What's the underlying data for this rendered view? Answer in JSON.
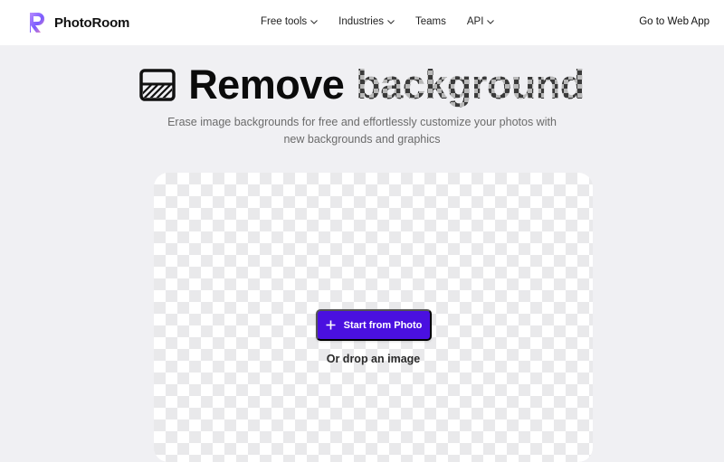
{
  "brand": {
    "name": "PhotoRoom",
    "logo_icon": "photoroom-logo-icon"
  },
  "nav": {
    "items": [
      {
        "label": "Free tools",
        "has_dropdown": true
      },
      {
        "label": "Industries",
        "has_dropdown": true
      },
      {
        "label": "Teams",
        "has_dropdown": false
      },
      {
        "label": "API",
        "has_dropdown": true
      }
    ],
    "cta": "Go to Web App"
  },
  "hero": {
    "icon": "remove-background-icon",
    "title_word_1": "Remove",
    "title_word_2": "background",
    "subtitle_line_1": "Erase image backgrounds for free and effortlessly customize your photos with",
    "subtitle_line_2": "new backgrounds and graphics"
  },
  "upload": {
    "button_label": "Start from Photo",
    "button_icon": "plus-icon",
    "drop_text": "Or drop an image"
  },
  "colors": {
    "accent": "#4a10e0",
    "page_background": "#f0f0f3",
    "navbar_background": "#ffffff"
  }
}
